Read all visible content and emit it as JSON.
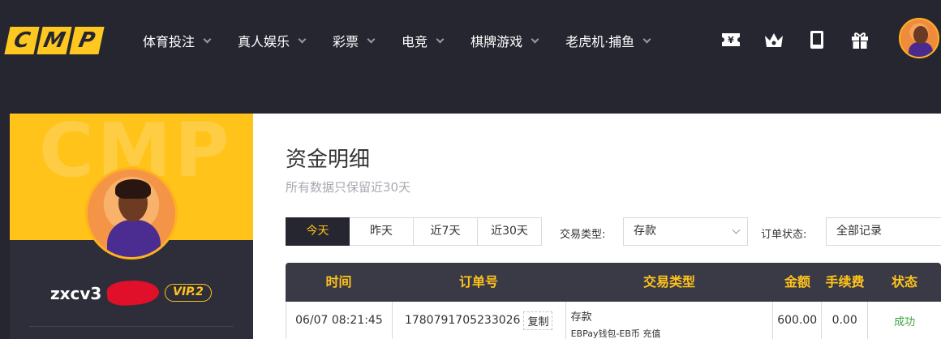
{
  "logo": {
    "letters": [
      "C",
      "M",
      "P"
    ]
  },
  "nav": [
    {
      "label": "体育投注"
    },
    {
      "label": "真人娱乐"
    },
    {
      "label": "彩票"
    },
    {
      "label": "电竞"
    },
    {
      "label": "棋牌游戏"
    },
    {
      "label": "老虎机·捕鱼"
    }
  ],
  "header_icons": [
    "yen-ticket-icon",
    "crown-icon",
    "mobile-phone-icon",
    "gift-icon"
  ],
  "colors": {
    "accent": "#ffc31a",
    "dark": "#262631",
    "success": "#3aa63a"
  },
  "profile": {
    "username": "zxcv3",
    "vip": "VIP.2",
    "watermark": "CMP"
  },
  "page": {
    "title": "资金明细",
    "subtitle": "所有数据只保留近30天"
  },
  "tabs": [
    {
      "label": "今天",
      "active": true
    },
    {
      "label": "昨天",
      "active": false
    },
    {
      "label": "近7天",
      "active": false
    },
    {
      "label": "近30天",
      "active": false
    }
  ],
  "filters": {
    "type_label": "交易类型:",
    "type_value": "存款",
    "status_label": "订单状态:",
    "status_value": "全部记录"
  },
  "table": {
    "headers": [
      "时间",
      "订单号",
      "交易类型",
      "金额",
      "手续费",
      "状态"
    ],
    "copy_label": "复制",
    "rows": [
      {
        "time": "06/07 08:21:45",
        "order": "1780791705233026",
        "type": "存款",
        "type_detail": "EBPay钱包-EB币 充值",
        "amount": "600.00",
        "fee": "0.00",
        "status": "成功"
      }
    ]
  }
}
